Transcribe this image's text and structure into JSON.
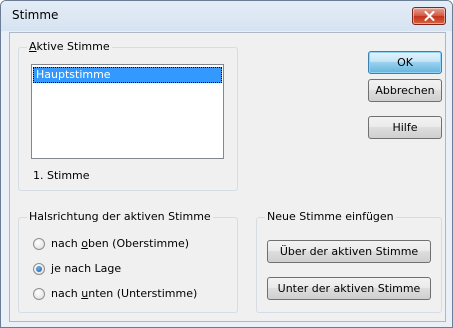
{
  "window": {
    "title": "Stimme"
  },
  "active_voice": {
    "legend_pre": "",
    "legend_u": "A",
    "legend_post": "ktive Stimme",
    "items": [
      "Hauptstimme"
    ],
    "status": "1.  Stimme"
  },
  "buttons": {
    "ok": "OK",
    "cancel": "Abbrechen",
    "help": "Hilfe"
  },
  "stem_direction": {
    "legend": "Halsrichtung der aktiven Stimme",
    "options": [
      {
        "pre": "nach ",
        "u": "o",
        "post": "ben  (Oberstimme)",
        "checked": false
      },
      {
        "pre": "",
        "u": "j",
        "post": "e nach Lage",
        "checked": true
      },
      {
        "pre": "nach ",
        "u": "u",
        "post": "nten  (Unterstimme)",
        "checked": false
      }
    ]
  },
  "new_voice": {
    "legend": "Neue Stimme einfügen",
    "above_label": "Über der aktiven Stimme",
    "below_label": "Unter der aktiven Stimme"
  }
}
